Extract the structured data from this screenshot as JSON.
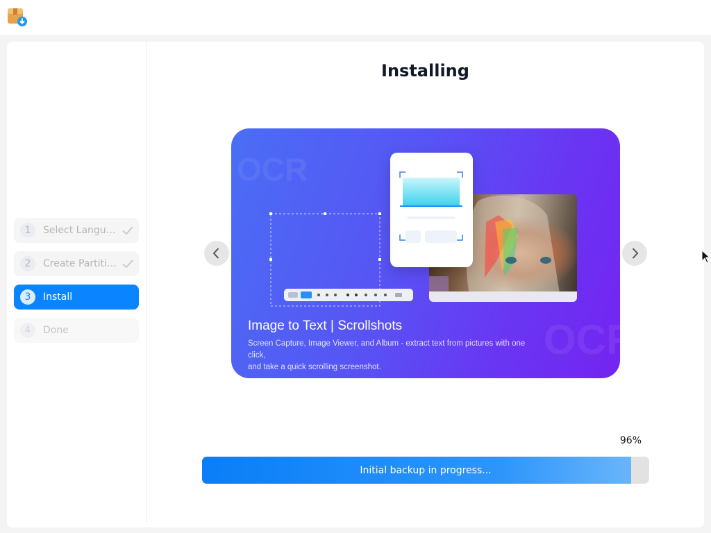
{
  "app": {
    "icon": "package-installer-icon"
  },
  "sidebar": {
    "steps": [
      {
        "number": "1",
        "label": "Select Language",
        "state": "done",
        "icon": "checkmark-icon"
      },
      {
        "number": "2",
        "label": "Create Partitions",
        "state": "done",
        "icon": "checkmark-icon"
      },
      {
        "number": "3",
        "label": "Install",
        "state": "active"
      },
      {
        "number": "4",
        "label": "Done",
        "state": "pending"
      }
    ]
  },
  "main": {
    "title": "Installing",
    "slideshow": {
      "prev_icon": "chevron-left-icon",
      "next_icon": "chevron-right-icon",
      "slide": {
        "title": "Image to Text | Scrollshots",
        "description_line1": "Screen Capture, Image Viewer, and Album - extract text from pictures with one click,",
        "description_line2": "and take a quick scrolling screenshot.",
        "watermark_top": "OCR",
        "watermark_bottom": "OCR"
      }
    },
    "progress": {
      "percent_label": "96%",
      "fraction": 0.96,
      "status": "Initial backup in progress..."
    }
  },
  "colors": {
    "accent": "#0a84ff",
    "progress_track": "#e2e2e2",
    "slide_gradient_start": "#4a6ef5",
    "slide_gradient_end": "#7424f0"
  }
}
